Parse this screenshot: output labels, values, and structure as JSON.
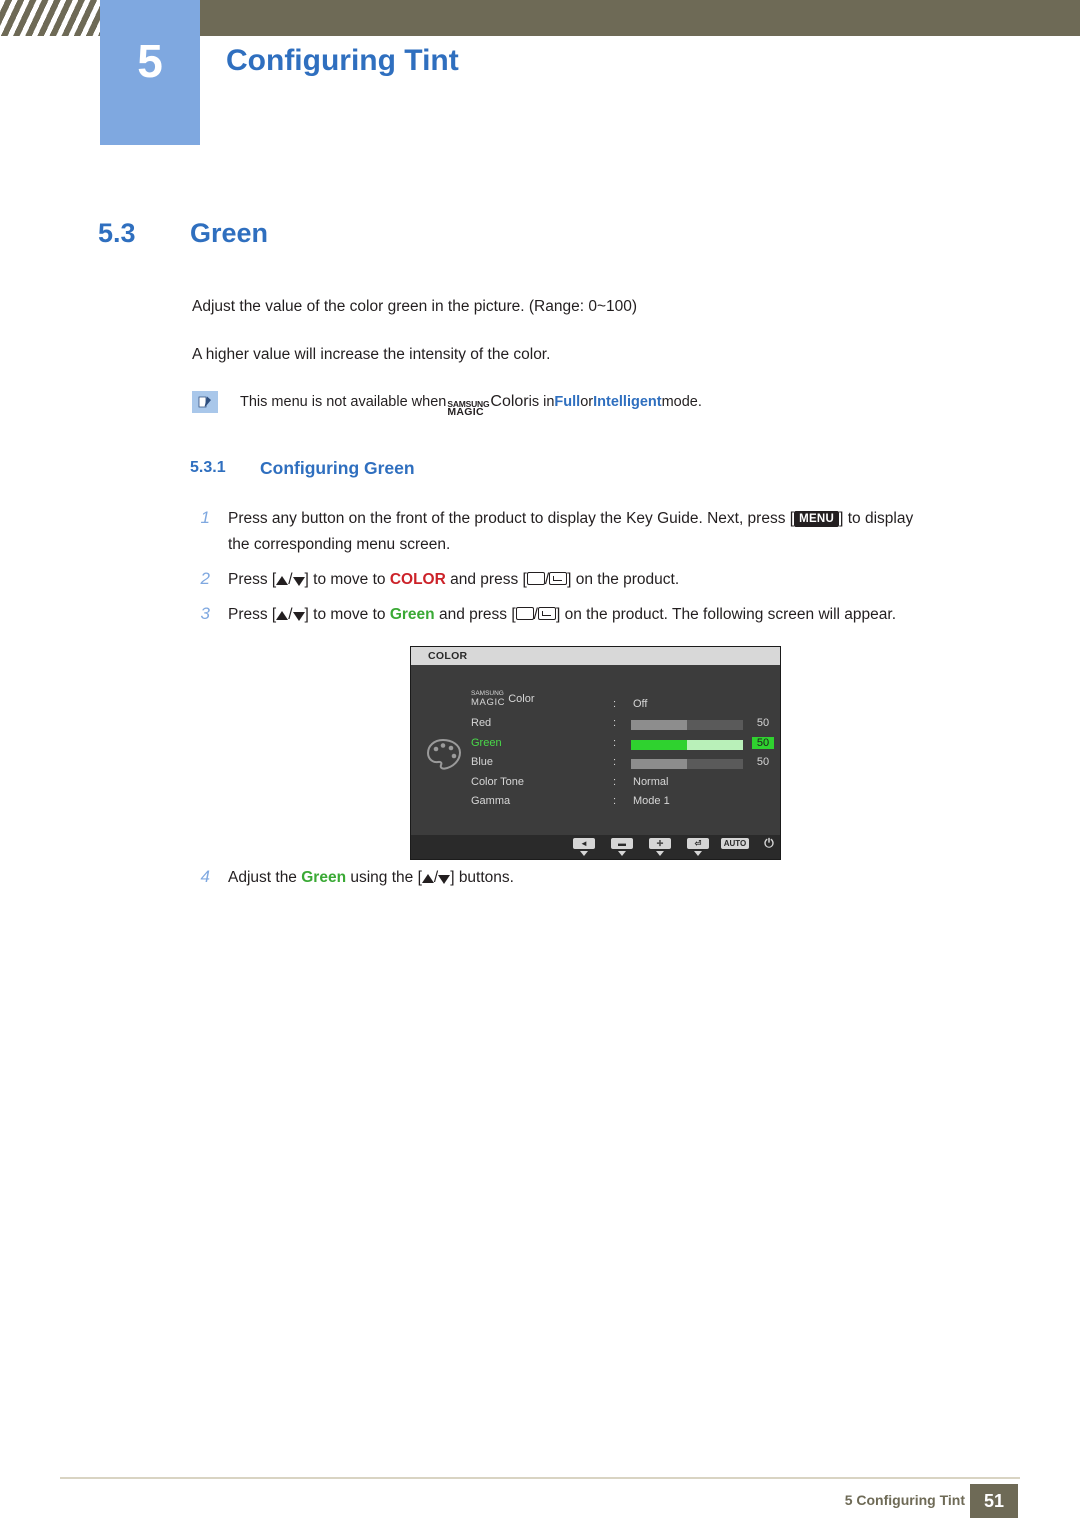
{
  "header": {
    "chapter_number": "5",
    "chapter_title": "Configuring Tint"
  },
  "section": {
    "number": "5.3",
    "title": "Green"
  },
  "body": {
    "paragraph1": "Adjust the value of the color green in the picture. (Range: 0~100)",
    "paragraph2": "A higher value will increase the intensity of the color."
  },
  "note": {
    "icon": "note-pencil-icon",
    "prefix": "This menu is not available when ",
    "magic_top": "SAMSUNG",
    "magic_bottom": "MAGIC",
    "magic_word": "Color",
    "mid": " is in ",
    "option1": "Full",
    "or": " or ",
    "option2": "Intelligent",
    "suffix": " mode."
  },
  "subsection": {
    "number": "5.3.1",
    "title": "Configuring Green"
  },
  "steps": [
    {
      "num": "1",
      "line1_a": "Press any button on the front of the product to display the Key Guide. Next, press [",
      "key": "MENU",
      "line1_b": "] to display",
      "line2": "the corresponding menu screen."
    },
    {
      "num": "2",
      "a": "Press [",
      "b": "/",
      "c": "] to move to ",
      "target": "COLOR",
      "d": " and press [",
      "e": "/",
      "f": "] on the product."
    },
    {
      "num": "3",
      "a": "Press [",
      "b": "/",
      "c": "] to move to ",
      "target": "Green",
      "d": " and press [",
      "e": "/",
      "f": "] on the product. The following screen will appear."
    },
    {
      "num": "4",
      "a": "Adjust the ",
      "target": "Green",
      "b": " using the [",
      "c": "/",
      "d": "] buttons."
    }
  ],
  "osd": {
    "title": "COLOR",
    "icon": "palette-icon",
    "rows": [
      {
        "label_top": "SAMSUNG",
        "label_bottom": "MAGIC",
        "label_word": " Color",
        "value": "Off",
        "type": "text"
      },
      {
        "label": "Red",
        "number": "50",
        "fill_percent": 50,
        "type": "bar",
        "selected": false
      },
      {
        "label": "Green",
        "number": "50",
        "fill_percent": 50,
        "type": "bar",
        "selected": true
      },
      {
        "label": "Blue",
        "number": "50",
        "fill_percent": 50,
        "type": "bar",
        "selected": false
      },
      {
        "label": "Color Tone",
        "value": "Normal",
        "type": "text"
      },
      {
        "label": "Gamma",
        "value": "Mode 1",
        "type": "text"
      }
    ],
    "colon": ":",
    "footer_keys": [
      {
        "name": "back-key",
        "glyph": "◄"
      },
      {
        "name": "minus-key",
        "glyph": "▬"
      },
      {
        "name": "plus-key",
        "glyph": "✛"
      },
      {
        "name": "enter-key",
        "glyph": "⏎"
      },
      {
        "name": "auto-key",
        "glyph": "AUTO"
      },
      {
        "name": "power-key",
        "glyph": "⏻"
      }
    ]
  },
  "footer": {
    "text": "5 Configuring Tint",
    "page": "51"
  },
  "colors": {
    "accent_blue": "#2f6fbf",
    "badge_blue": "#7fa8e0",
    "header_olive": "#6e6a56",
    "red": "#cc2229",
    "green": "#3aa935",
    "osd_green": "#2fd22f"
  }
}
